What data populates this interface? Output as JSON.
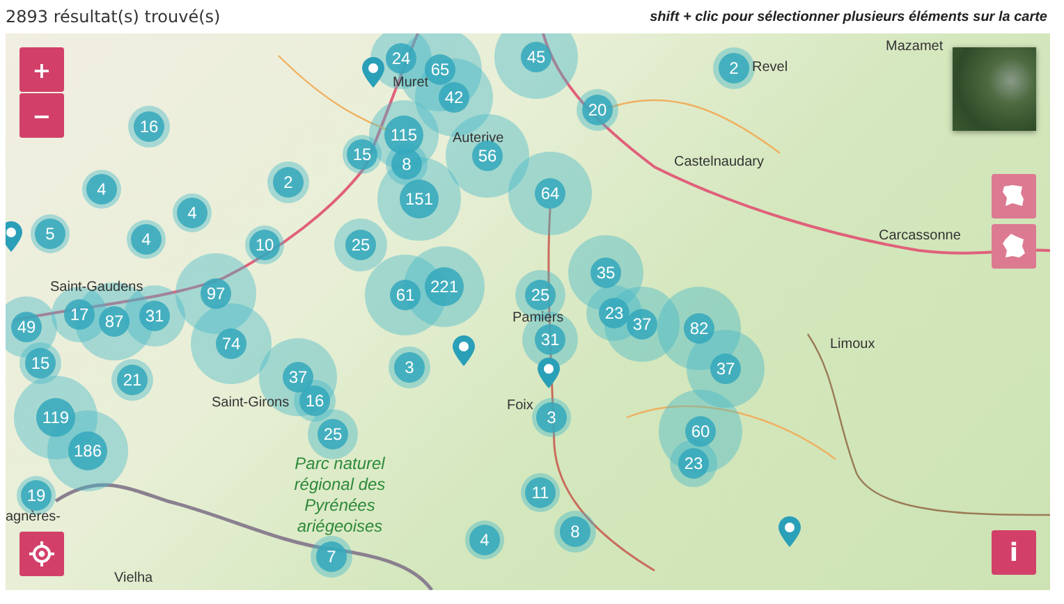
{
  "header": {
    "result_count": "2893 résultat(s) trouvé(s)",
    "hint": "shift + clic pour sélectionner plusieurs éléments sur la carte"
  },
  "map": {
    "controls": {
      "zoom_in": "+",
      "zoom_out": "−",
      "info": "i"
    },
    "place_labels": [
      "Muret",
      "Revel",
      "Mazamet",
      "Auterive",
      "Castelnaudary",
      "Carcassonne",
      "Saint-Gaudens",
      "Pamiers",
      "Limoux",
      "Saint-Girons",
      "Foix",
      "agnères-",
      "Vielha"
    ],
    "park_label": "Parc naturel régional des Pyrénées ariégeoises",
    "clusters": [
      {
        "count": "45"
      },
      {
        "count": "24"
      },
      {
        "count": "2"
      },
      {
        "count": "65"
      },
      {
        "count": "42"
      },
      {
        "count": "16"
      },
      {
        "count": "20"
      },
      {
        "count": "115"
      },
      {
        "count": "15"
      },
      {
        "count": "8"
      },
      {
        "count": "56"
      },
      {
        "count": "2"
      },
      {
        "count": "4"
      },
      {
        "count": "64"
      },
      {
        "count": "151"
      },
      {
        "count": "4"
      },
      {
        "count": "5"
      },
      {
        "count": "4"
      },
      {
        "count": "10"
      },
      {
        "count": "25"
      },
      {
        "count": "35"
      },
      {
        "count": "97"
      },
      {
        "count": "61"
      },
      {
        "count": "221"
      },
      {
        "count": "25"
      },
      {
        "count": "23"
      },
      {
        "count": "37"
      },
      {
        "count": "82"
      },
      {
        "count": "17"
      },
      {
        "count": "87"
      },
      {
        "count": "31"
      },
      {
        "count": "49"
      },
      {
        "count": "74"
      },
      {
        "count": "31"
      },
      {
        "count": "37"
      },
      {
        "count": "15"
      },
      {
        "count": "21"
      },
      {
        "count": "3"
      },
      {
        "count": "37"
      },
      {
        "count": "16"
      },
      {
        "count": "3"
      },
      {
        "count": "60"
      },
      {
        "count": "25"
      },
      {
        "count": "119"
      },
      {
        "count": "186"
      },
      {
        "count": "23"
      },
      {
        "count": "19"
      },
      {
        "count": "11"
      },
      {
        "count": "8"
      },
      {
        "count": "4"
      },
      {
        "count": "7"
      }
    ]
  }
}
